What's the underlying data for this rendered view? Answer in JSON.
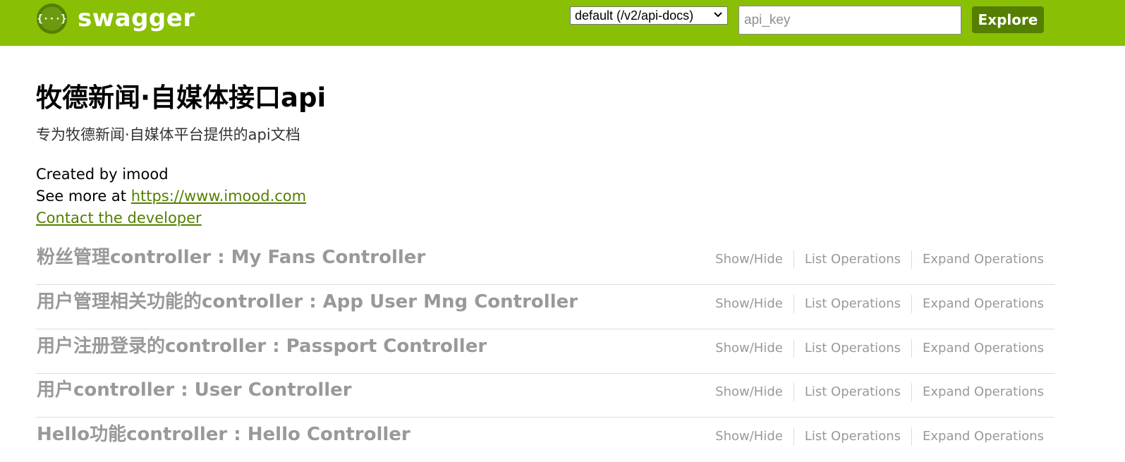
{
  "header": {
    "brand": "swagger",
    "logo_icon": "swagger-braces-icon",
    "spec_select": {
      "selected": "default (/v2/api-docs)",
      "chevron_icon": "chevron-down-icon"
    },
    "api_key": {
      "placeholder": "api_key",
      "value": ""
    },
    "explore_label": "Explore",
    "colors": {
      "bar": "#89bf04",
      "accent": "#547f00"
    }
  },
  "info": {
    "title": "牧德新闻·自媒体接口api",
    "description": "专为牧德新闻·自媒体平台提供的api文档",
    "created_by": "Created by imood",
    "see_more_prefix": "See more at ",
    "see_more_link": "https://www.imood.com",
    "contact_link": "Contact the developer"
  },
  "resources": [
    {
      "heading": "粉丝管理controller : My Fans Controller",
      "show_hide": "Show/Hide",
      "list_ops": "List Operations",
      "expand_ops": "Expand Operations"
    },
    {
      "heading": "用户管理相关功能的controller : App User Mng Controller",
      "show_hide": "Show/Hide",
      "list_ops": "List Operations",
      "expand_ops": "Expand Operations"
    },
    {
      "heading": "用户注册登录的controller : Passport Controller",
      "show_hide": "Show/Hide",
      "list_ops": "List Operations",
      "expand_ops": "Expand Operations"
    },
    {
      "heading": "用户controller : User Controller",
      "show_hide": "Show/Hide",
      "list_ops": "List Operations",
      "expand_ops": "Expand Operations"
    },
    {
      "heading": "Hello功能controller : Hello Controller",
      "show_hide": "Show/Hide",
      "list_ops": "List Operations",
      "expand_ops": "Expand Operations"
    }
  ]
}
